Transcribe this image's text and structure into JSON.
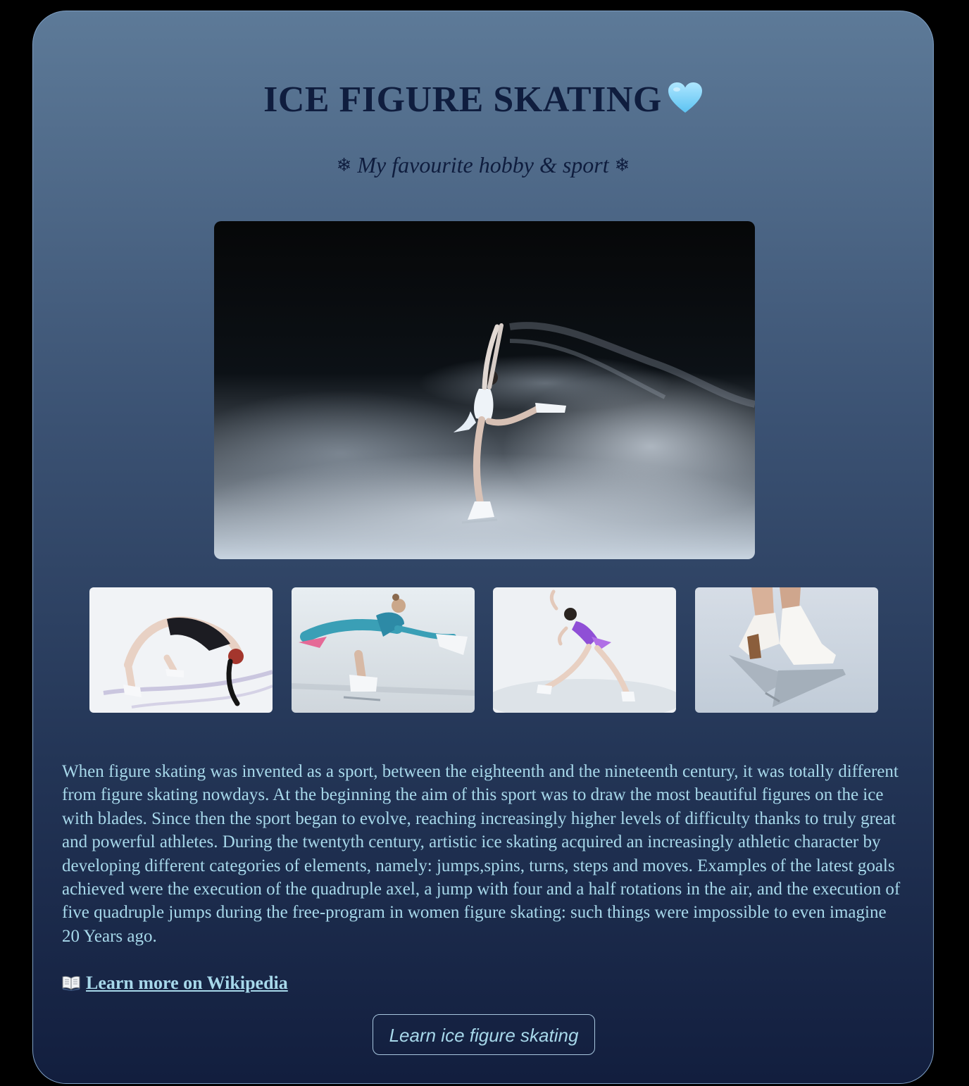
{
  "page": {
    "title": "ICE FIGURE SKATING",
    "title_icon": "light-blue-heart-icon",
    "subtitle": "My favourite hobby & sport",
    "subtitle_icon": "snowflake-icon"
  },
  "gallery": {
    "hero_image": "skater-spiral-in-mist-photo",
    "thumbnails": [
      "skater-backbend-black-dress-photo",
      "skater-sit-spin-teal-dress-photo",
      "skater-layback-purple-dress-photo",
      "white-figure-skates-closeup-photo"
    ]
  },
  "content": {
    "paragraph": "When figure skating was invented as a sport, between the eighteenth and the nineteenth century, it was totally different from figure skating nowdays. At the beginning the aim of this sport was to draw the most beautiful figures on the ice with blades. Since then the sport began to evolve, reaching increasingly higher levels of difficulty thanks to truly great and powerful athletes. During the twentyth century, artistic ice skating acquired an increasingly athletic character by developing different categories of elements, namely: jumps,spins, turns, steps and moves. Examples of the latest goals achieved were the execution of the quadruple axel, a jump with four and a half rotations in the air, and the execution of five quadruple jumps during the free-program in women figure skating: such things were impossible to even imagine 20 Years ago.",
    "wiki_link_label": "Learn more on Wikipedia",
    "wiki_icon": "open-book-icon"
  },
  "cta": {
    "label": "Learn ice figure skating"
  },
  "colors": {
    "page_background": "#000000",
    "card_gradient_top": "#5d7a98",
    "card_gradient_bottom": "#121e3e",
    "heading_text": "#0f1d3e",
    "body_text": "#a7d8ea",
    "card_border": "#7e9fc4"
  }
}
